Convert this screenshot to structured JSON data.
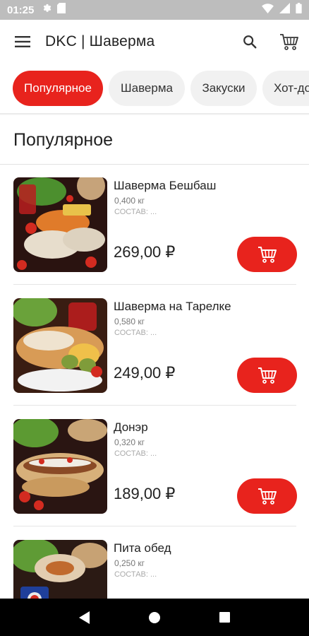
{
  "status_bar": {
    "time": "01:25",
    "left_icons": [
      "gear-icon",
      "sd-card-icon"
    ],
    "right_icons": [
      "wifi-icon",
      "signal-icon",
      "battery-icon"
    ]
  },
  "app_bar": {
    "title": "DKC | Шаверма",
    "menu_icon": "hamburger-menu-icon",
    "search_icon": "search-icon",
    "cart_icon": "cart-icon"
  },
  "categories": [
    {
      "label": "Популярное",
      "active": true
    },
    {
      "label": "Шаверма",
      "active": false
    },
    {
      "label": "Закуски",
      "active": false
    },
    {
      "label": "Хот-до",
      "active": false
    }
  ],
  "section": {
    "title": "Популярное"
  },
  "products": [
    {
      "name": "Шаверма Бешбаш",
      "weight": "0,400 кг",
      "desc": "СОСТАВ: ...",
      "price": "269,00 ₽"
    },
    {
      "name": "Шаверма на Тарелке",
      "weight": "0,580 кг",
      "desc": "СОСТАВ: ...",
      "price": "249,00 ₽"
    },
    {
      "name": "Донэр",
      "weight": "0,320 кг",
      "desc": "СОСТАВ: ...",
      "price": "189,00 ₽"
    },
    {
      "name": "Пита обед",
      "weight": "0,250 кг",
      "desc": "СОСТАВ: ...",
      "price": ""
    }
  ],
  "colors": {
    "accent": "#e8231d",
    "status_bar": "#bdbdbd",
    "nav_bar": "#000000",
    "chip_bg": "#f1f1f1"
  },
  "nav_bar": {
    "icons": [
      "back-icon",
      "home-icon",
      "recents-icon"
    ]
  }
}
